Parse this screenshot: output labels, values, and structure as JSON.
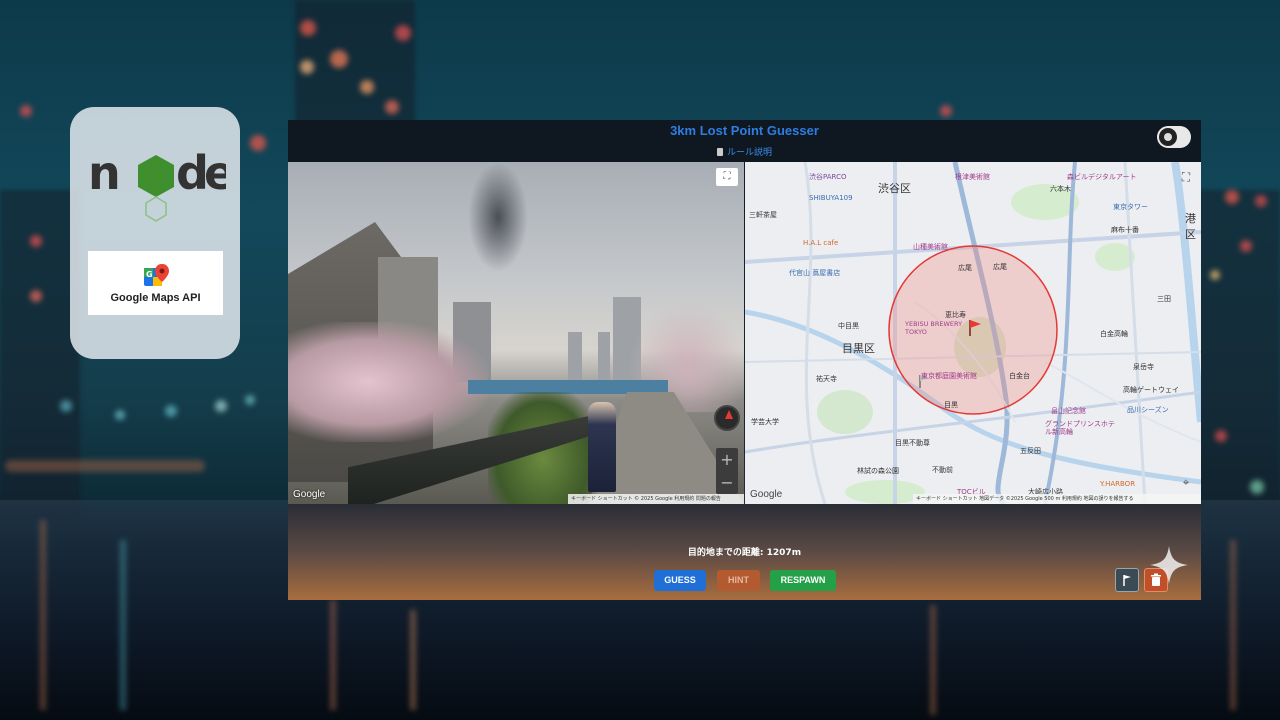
{
  "logos": {
    "node_name": "node",
    "gmaps_label": "Google Maps API"
  },
  "app": {
    "title": "3km Lost Point Guesser",
    "rules_link": "ルール説明"
  },
  "streetview": {
    "google_mark": "Google",
    "attribution": "キーボード ショートカット  © 2025 Google  利用規約  問題の報告"
  },
  "map": {
    "google_mark": "Google",
    "attribution": "キーボード ショートカット  地図データ ©2025 Google  500 m  利用規約  地図の誤りを報告する",
    "wards": [
      "渋谷区",
      "目黒区",
      "港区"
    ],
    "labels": {
      "shibuya_parco": "渋谷PARCO",
      "shibuya109": "SHIBUYA109",
      "hal_cafe": "H.A.L cafe",
      "yamatane": "山種美術館",
      "daikanyama": "代官山 蔦屋書店",
      "yebisu": "YEBISU BREWERY TOKYO",
      "teien": "東京都庭園美術館",
      "hibiya": "広尾",
      "shirokanedai": "白金台",
      "meguro": "目黒",
      "ebisu": "恵比寿",
      "nakameguro": "中目黒",
      "yutenji": "祐天寺",
      "rinshi": "林試の森公園",
      "gotanda": "五反田",
      "fudomae": "不動前",
      "tocbldg": "TOCビル",
      "harbor": "Y.HARBOR",
      "tokyo_tower": "東京タワー",
      "azabujuban": "麻布十番",
      "shirokanetakanawa": "白金高輪",
      "takanawa_gateway": "高輪ゲートウェイ",
      "shinagawa": "品川シーズン",
      "grand_prince": "グランドプリンスホテル新高輪",
      "hatakeyama": "畠山記念館",
      "mita": "三田",
      "sengakuji": "泉岳寺",
      "osaki": "大崎広小路",
      "roppongi": "六本木",
      "mori": "森ビルデジタルアート",
      "nezu": "根津美術館",
      "sangenjaya": "三軒茶屋",
      "gakugeidai": "学芸大学",
      "hiroo": "広尾",
      "meguro_fudoson": "目黒不動尊"
    }
  },
  "status": {
    "distance": "目的地までの距離: 1207m"
  },
  "buttons": {
    "guess": "GUESS",
    "hint": "HINT",
    "respawn": "RESPAWN"
  },
  "colors": {
    "title_blue": "#2f7de0",
    "guess": "#1f6fd6",
    "hint": "#b35a30",
    "respawn": "#24a148",
    "radius_circle": "#e53935"
  },
  "icons": [
    "node-js-logo",
    "google-maps-pin-icon",
    "clipboard-icon",
    "theme-toggle-icon",
    "fullscreen-icon",
    "compass-icon",
    "zoom-in-icon",
    "zoom-out-icon",
    "locate-icon",
    "flag-icon",
    "trash-icon",
    "sparkle-icon"
  ]
}
